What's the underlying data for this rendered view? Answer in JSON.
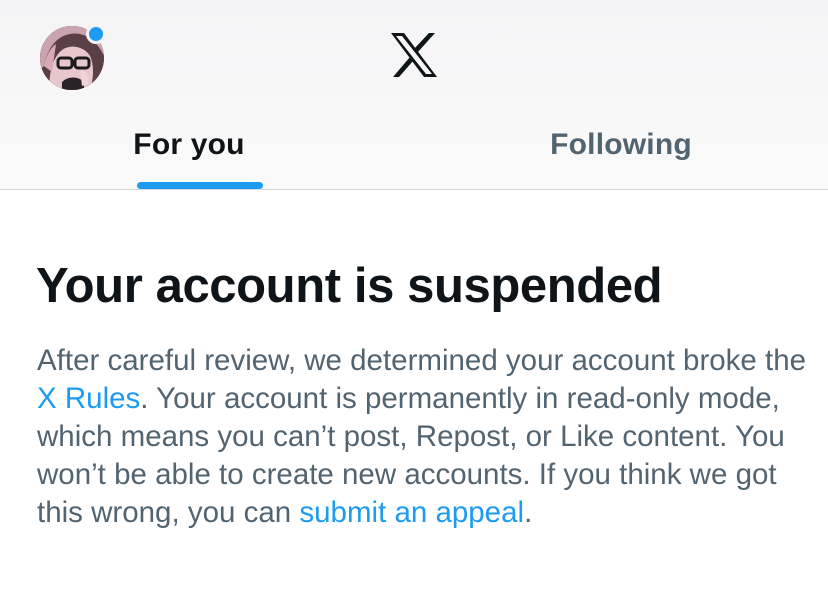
{
  "header": {
    "logo_icon": "x-logo-icon",
    "avatar_icon": "profile-avatar",
    "notification_dot_color": "#1d9bf0"
  },
  "tabs": [
    {
      "label": "For you",
      "active": true
    },
    {
      "label": "Following",
      "active": false
    }
  ],
  "notice": {
    "title": "Your account is suspended",
    "body_part1": "After careful review, we determined your account broke the ",
    "rules_link": "X Rules",
    "body_part2": ". Your account is permanently in read-only mode, which means you can’t post, Repost, or Like content. You won’t be able to create new accounts. If you think we got this wrong, you can ",
    "appeal_link": "submit an appeal",
    "body_end": "."
  },
  "colors": {
    "accent": "#1d9bf0",
    "text_primary": "#0f1419",
    "text_secondary": "#536471"
  }
}
